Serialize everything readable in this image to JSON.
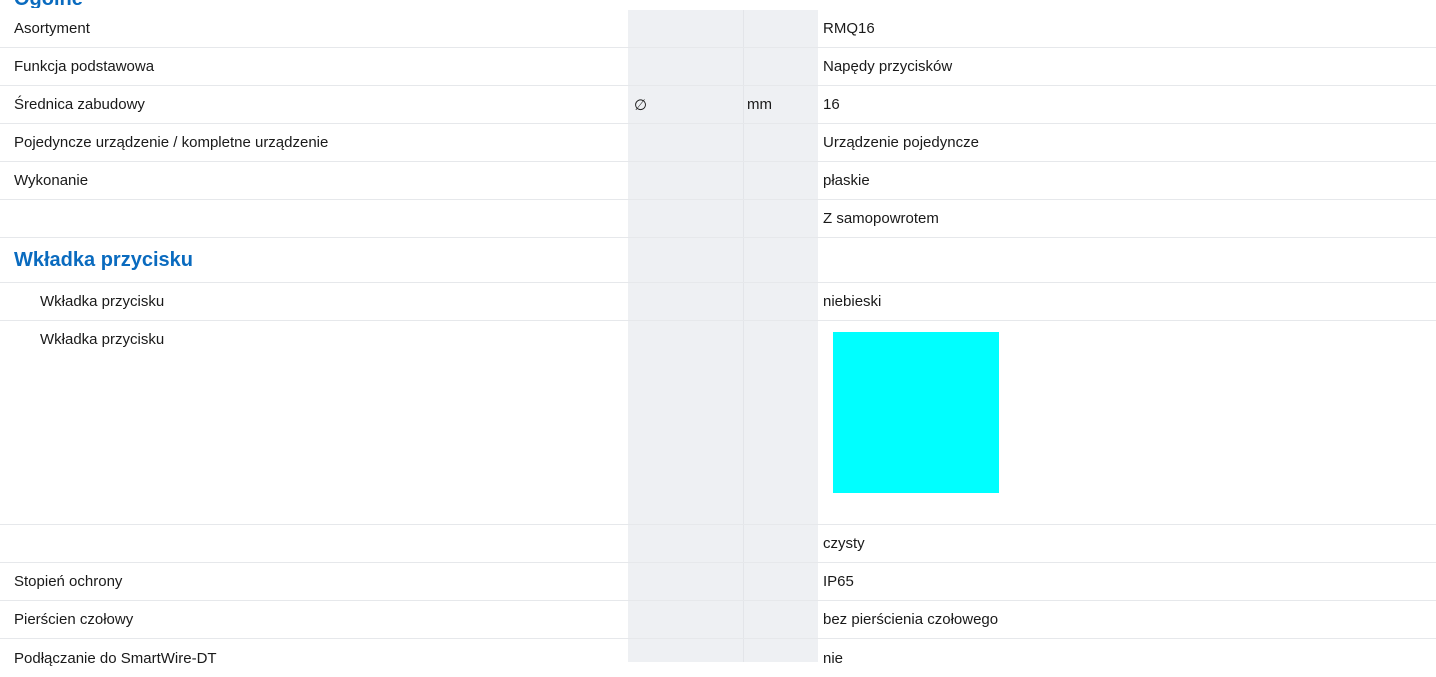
{
  "section_prev": "Ogólne",
  "rows": [
    {
      "label": "Asortyment",
      "symbol": "",
      "unit": "",
      "value": "RMQ16"
    },
    {
      "label": "Funkcja podstawowa",
      "symbol": "",
      "unit": "",
      "value": "Napędy przycisków"
    },
    {
      "label": "Średnica zabudowy",
      "symbol": "∅",
      "unit": "mm",
      "value": "16"
    },
    {
      "label": "Pojedyncze urządzenie / kompletne urządzenie",
      "symbol": "",
      "unit": "",
      "value": "Urządzenie pojedyncze"
    },
    {
      "label": "Wykonanie",
      "symbol": "",
      "unit": "",
      "value": "płaskie"
    },
    {
      "label": "",
      "symbol": "",
      "unit": "",
      "value": "Z samopowrotem"
    }
  ],
  "section_insert": {
    "heading": "Wkładka przycisku",
    "color_label": "Wkładka przycisku",
    "color_value": "niebieski",
    "swatch_label": "Wkładka przycisku",
    "swatch_color": "#00ffff",
    "extra_value": "czysty"
  },
  "rows_after": [
    {
      "label": "Stopień ochrony",
      "value": "IP65"
    },
    {
      "label": "Pierścien czołowy",
      "value": "bez pierścienia czołowego"
    },
    {
      "label": "Podłączanie do SmartWire-DT",
      "value": "nie"
    }
  ]
}
